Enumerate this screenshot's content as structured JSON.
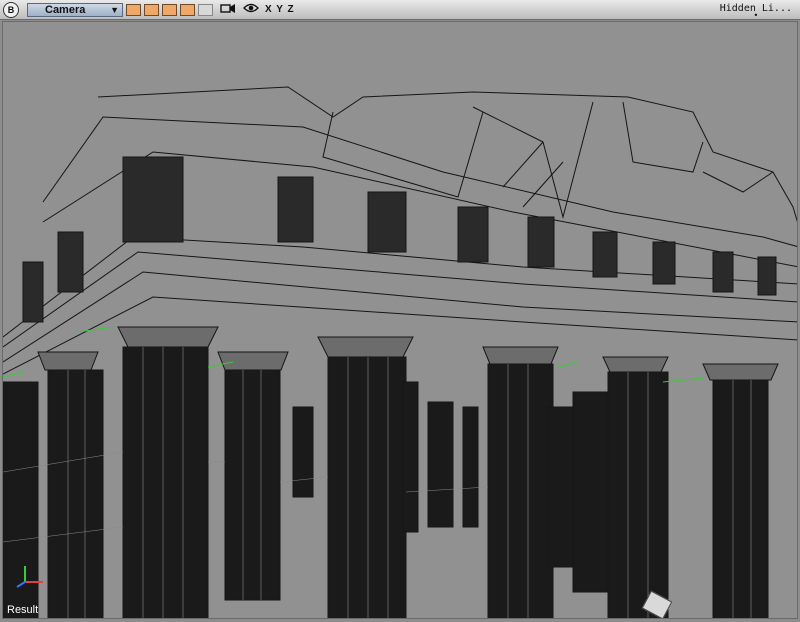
{
  "toolbar": {
    "b_button": "B",
    "camera_label": "Camera",
    "dropdown_arrow": "▼",
    "shading_swatches": [
      "on",
      "on",
      "on",
      "on",
      "off"
    ],
    "camera_icon": "camera-icon",
    "eye_icon": "eye-icon",
    "axes_label": "X Y Z",
    "view_mode": "Hidden Li..."
  },
  "viewport": {
    "status_label": "Result",
    "background": "#919191",
    "wire_color": "#151515",
    "edge_green": "#3cc83c"
  }
}
